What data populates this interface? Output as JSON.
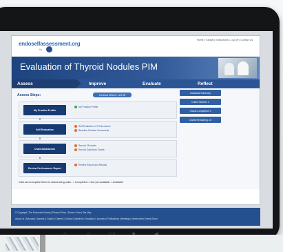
{
  "site": {
    "logo_text": "endoselfassessment.org",
    "logo_by": "by",
    "top_links": "Home | Tutorial | Instructions | Log Off | Contact Us"
  },
  "banner": {
    "title": "Evaluation of Thyroid Nodules PIM"
  },
  "tabs": [
    {
      "label": "Assess"
    },
    {
      "label": "Improve"
    },
    {
      "label": "Evaluate"
    },
    {
      "label": "Reflect"
    }
  ],
  "content": {
    "steps_title": "Assess Steps:",
    "continue_label": "Continue Where I Left Off",
    "steps": [
      {
        "label": "My Practice Profile",
        "links": [
          "My Practice Profile"
        ],
        "statuses": [
          "green"
        ]
      },
      {
        "label": "Self Evaluation",
        "links": [
          "Self Evaluation of Performance",
          "Baseline Practice Scorecards"
        ],
        "statuses": [
          "orange",
          "orange"
        ]
      },
      {
        "label": "Chart Abstraction",
        "links": [
          "Record 25 charts",
          "Record Data from Charts"
        ],
        "statuses": [
          "orange",
          "orange"
        ]
      },
      {
        "label": "Review Performance Report",
        "links": [
          "Review Report and Results"
        ],
        "statuses": [
          "orange"
        ]
      }
    ],
    "legend": "Click and complete items in descending order.  = Completed  = Not yet available  = Available"
  },
  "sidebar": {
    "items": [
      {
        "label": "Individual Summary"
      },
      {
        "label": "Charts Started: 1"
      },
      {
        "label": "Charts Completed: 0"
      },
      {
        "label": "Charts Remaining: 24"
      }
    ]
  },
  "footer": {
    "line1": "© Copyright | The Endocrine Society | Privacy Policy | Terms of Use | Site Map",
    "line2": "About Us | Advocacy | Awards & Grants | Careers | Clinical Guidelines | Education | Journals & Publications | Meetings | Membership | News Room"
  },
  "colors": {
    "brand_blue": "#1e447f",
    "tab_bar": "#2c5596",
    "completed": "#4aa34a",
    "not_available": "#e46c2b",
    "available": "#f0a11d"
  }
}
